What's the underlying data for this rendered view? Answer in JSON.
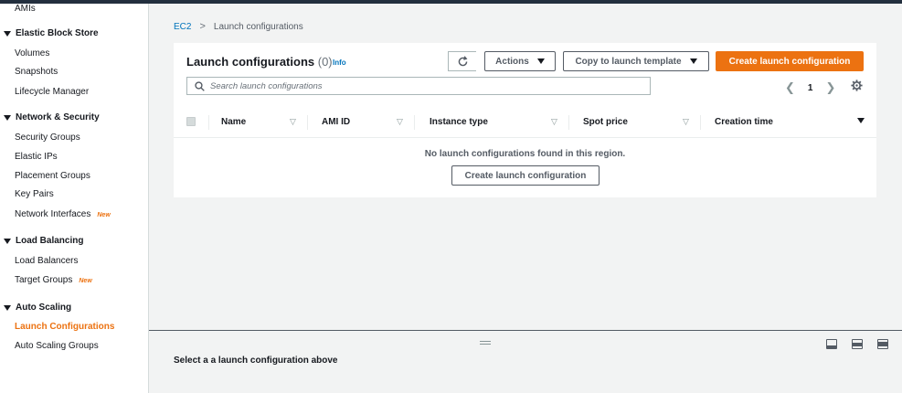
{
  "sidebar": {
    "top_item": "AMIs",
    "sections": [
      {
        "heading": "Elastic Block Store",
        "items": [
          "Volumes",
          "Snapshots",
          "Lifecycle Manager"
        ]
      },
      {
        "heading": "Network & Security",
        "items": [
          "Security Groups",
          "Elastic IPs",
          "Placement Groups",
          "Key Pairs",
          "Network Interfaces"
        ]
      },
      {
        "heading": "Load Balancing",
        "items": [
          "Load Balancers",
          "Target Groups"
        ]
      },
      {
        "heading": "Auto Scaling",
        "items": [
          "Launch Configurations",
          "Auto Scaling Groups"
        ]
      }
    ],
    "new_badge": "New"
  },
  "breadcrumb": {
    "root": "EC2",
    "separator": ">",
    "current": "Launch configurations"
  },
  "panel": {
    "title": "Launch configurations",
    "count": "(0)",
    "info": "Info",
    "actions_label": "Actions",
    "copy_label": "Copy to launch template",
    "create_label": "Create launch configuration",
    "search_placeholder": "Search launch configurations",
    "page": "1",
    "columns": [
      "Name",
      "AMI ID",
      "Instance type",
      "Spot price",
      "Creation time"
    ],
    "empty_message": "No launch configurations found in this region.",
    "empty_create_label": "Create launch configuration"
  },
  "split_panel": {
    "message": "Select a a launch configuration above"
  },
  "colors": {
    "primary": "#ec7211",
    "link": "#0073bb",
    "header_dark": "#232f3e"
  }
}
